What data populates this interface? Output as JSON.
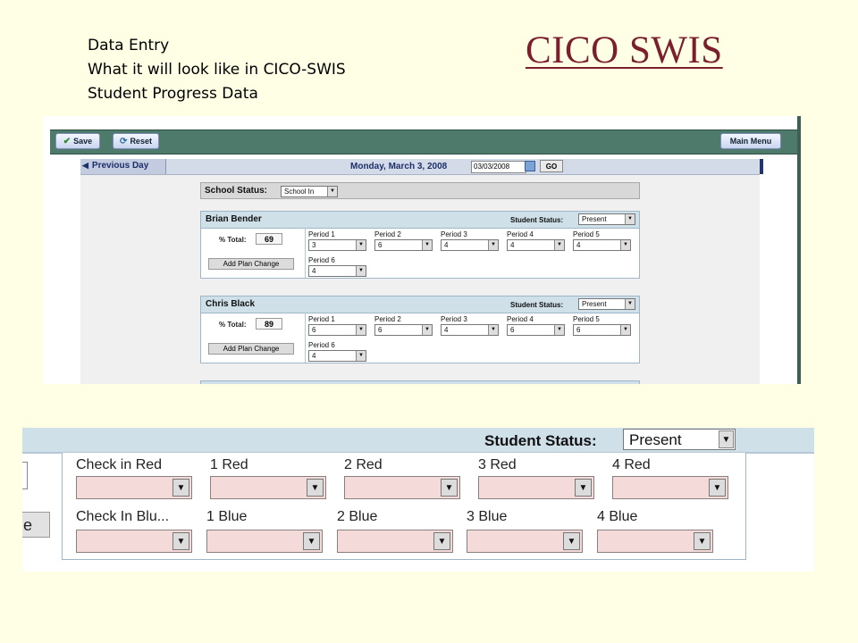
{
  "caption": {
    "line1": "Data Entry",
    "line2": "What it will look like in CICO-SWIS",
    "line3": "Student Progress Data"
  },
  "brand": "CICO SWIS",
  "screen1": {
    "toolbar": {
      "save_label": "Save",
      "reset_label": "Reset",
      "main_menu_label": "Main Menu"
    },
    "nav": {
      "prev_day_label": "Previous Day",
      "date_label": "Monday, March 3, 2008",
      "date_value": "03/03/2008",
      "go_label": "GO"
    },
    "school_status": {
      "label": "School Status:",
      "value": "School In"
    },
    "students": [
      {
        "name": "Brian Bender",
        "status_label": "Student Status:",
        "status": "Present",
        "pct_label": "% Total:",
        "pct_total": "69",
        "plan_change_label": "Add Plan Change",
        "periods": [
          {
            "label": "Period 1",
            "value": "3"
          },
          {
            "label": "Period 2",
            "value": "6"
          },
          {
            "label": "Period 3",
            "value": "4"
          },
          {
            "label": "Period 4",
            "value": "4"
          },
          {
            "label": "Period 5",
            "value": "4"
          },
          {
            "label": "Period 6",
            "value": "4"
          }
        ]
      },
      {
        "name": "Chris Black",
        "status_label": "Student Status:",
        "status": "Present",
        "pct_label": "% Total:",
        "pct_total": "89",
        "plan_change_label": "Add Plan Change",
        "periods": [
          {
            "label": "Period 1",
            "value": "6"
          },
          {
            "label": "Period 2",
            "value": "6"
          },
          {
            "label": "Period 3",
            "value": "4"
          },
          {
            "label": "Period 4",
            "value": "6"
          },
          {
            "label": "Period 5",
            "value": "6"
          },
          {
            "label": "Period 6",
            "value": "4"
          }
        ]
      }
    ]
  },
  "screen2": {
    "status_label": "Student Status:",
    "status_value": "Present",
    "partial_button_text": "e",
    "red_labels": [
      "Check in Red",
      "1 Red",
      "2 Red",
      "3 Red",
      "4 Red"
    ],
    "blue_labels": [
      "Check In Blu...",
      "1 Blue",
      "2 Blue",
      "3 Blue",
      "4 Blue"
    ]
  },
  "colors": {
    "background": "#FFFFE5",
    "brand": "#7A1F2B",
    "toolbar": "#4E7A6B",
    "student_header": "#CFE0E8",
    "pink_field": "#F5DADA"
  },
  "icons": [
    "checkmark-icon",
    "refresh-icon",
    "left-arrow-icon",
    "calendar-icon",
    "dropdown-arrow-icon"
  ]
}
